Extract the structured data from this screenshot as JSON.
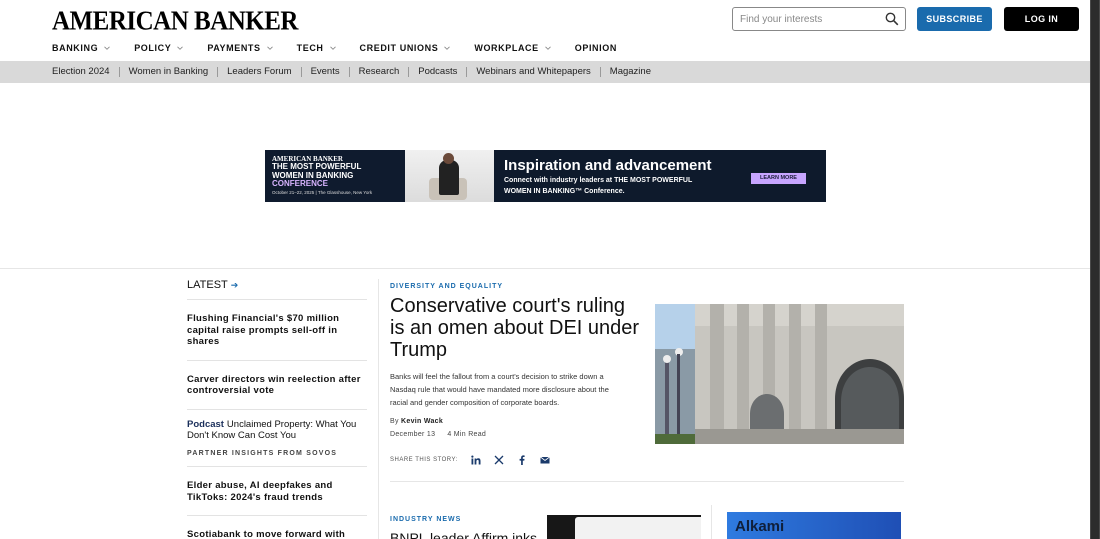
{
  "header": {
    "logo": "AMERICAN BANKER",
    "search_placeholder": "Find your interests",
    "subscribe_label": "SUBSCRIBE",
    "login_label": "LOG IN"
  },
  "main_nav": [
    {
      "label": "BANKING",
      "has_dropdown": true
    },
    {
      "label": "POLICY",
      "has_dropdown": true
    },
    {
      "label": "PAYMENTS",
      "has_dropdown": true
    },
    {
      "label": "TECH",
      "has_dropdown": true
    },
    {
      "label": "CREDIT UNIONS",
      "has_dropdown": true
    },
    {
      "label": "WORKPLACE",
      "has_dropdown": true
    },
    {
      "label": "OPINION",
      "has_dropdown": false
    }
  ],
  "sub_nav": [
    "Election 2024",
    "Women in Banking",
    "Leaders Forum",
    "Events",
    "Research",
    "Podcasts",
    "Webinars and Whitepapers",
    "Magazine"
  ],
  "ad": {
    "brand": "AMERICAN BANKER",
    "title_line1": "THE MOST POWERFUL",
    "title_line2": "WOMEN IN BANKING",
    "title_line3": "CONFERENCE",
    "dates": "October 21–22, 2025 | The Glasshouse, New York",
    "headline": "Inspiration and advancement",
    "body_line1": "Connect with industry leaders at THE MOST POWERFUL",
    "body_line2": "WOMEN IN BANKING™ Conference.",
    "cta": "LEARN MORE"
  },
  "latest": {
    "heading": "LATEST",
    "arrow": "➔",
    "items": [
      {
        "title": "Flushing Financial's $70 million capital raise prompts sell-off in shares"
      },
      {
        "title": "Carver directors win reelection after controversial vote"
      },
      {
        "prefix": "Podcast",
        "title": "Unclaimed Property: What You Don't Know Can Cost You",
        "partner": "PARTNER INSIGHTS FROM SOVOS"
      },
      {
        "title": "Elder abuse, AI deepfakes and TikToks: 2024's fraud trends"
      },
      {
        "title": "Scotiabank to move forward with KeyCorp investment"
      }
    ]
  },
  "feature": {
    "kicker": "DIVERSITY AND EQUALITY",
    "title": "Conservative court's ruling is an omen about DEI under Trump",
    "dek": "Banks will feel the fallout from a court's decision to strike down a Nasdaq rule that would have mandated more disclosure about the racial and gender composition of corporate boards.",
    "by_label": "By",
    "author": "Kevin Wack",
    "date": "December 13",
    "read_time": "4 Min Read",
    "share_label": "SHARE THIS STORY:",
    "share_icons": [
      "linkedin-icon",
      "x-icon",
      "facebook-icon",
      "email-icon"
    ]
  },
  "second_story": {
    "kicker": "INDUSTRY NEWS",
    "title_partial": "BNPL leader Affirm inks"
  },
  "side_ad": {
    "text": "Alkami"
  },
  "colors": {
    "accent_blue": "#1a6bad",
    "login_black": "#000000",
    "subnav_bg": "#d9d9d9"
  }
}
